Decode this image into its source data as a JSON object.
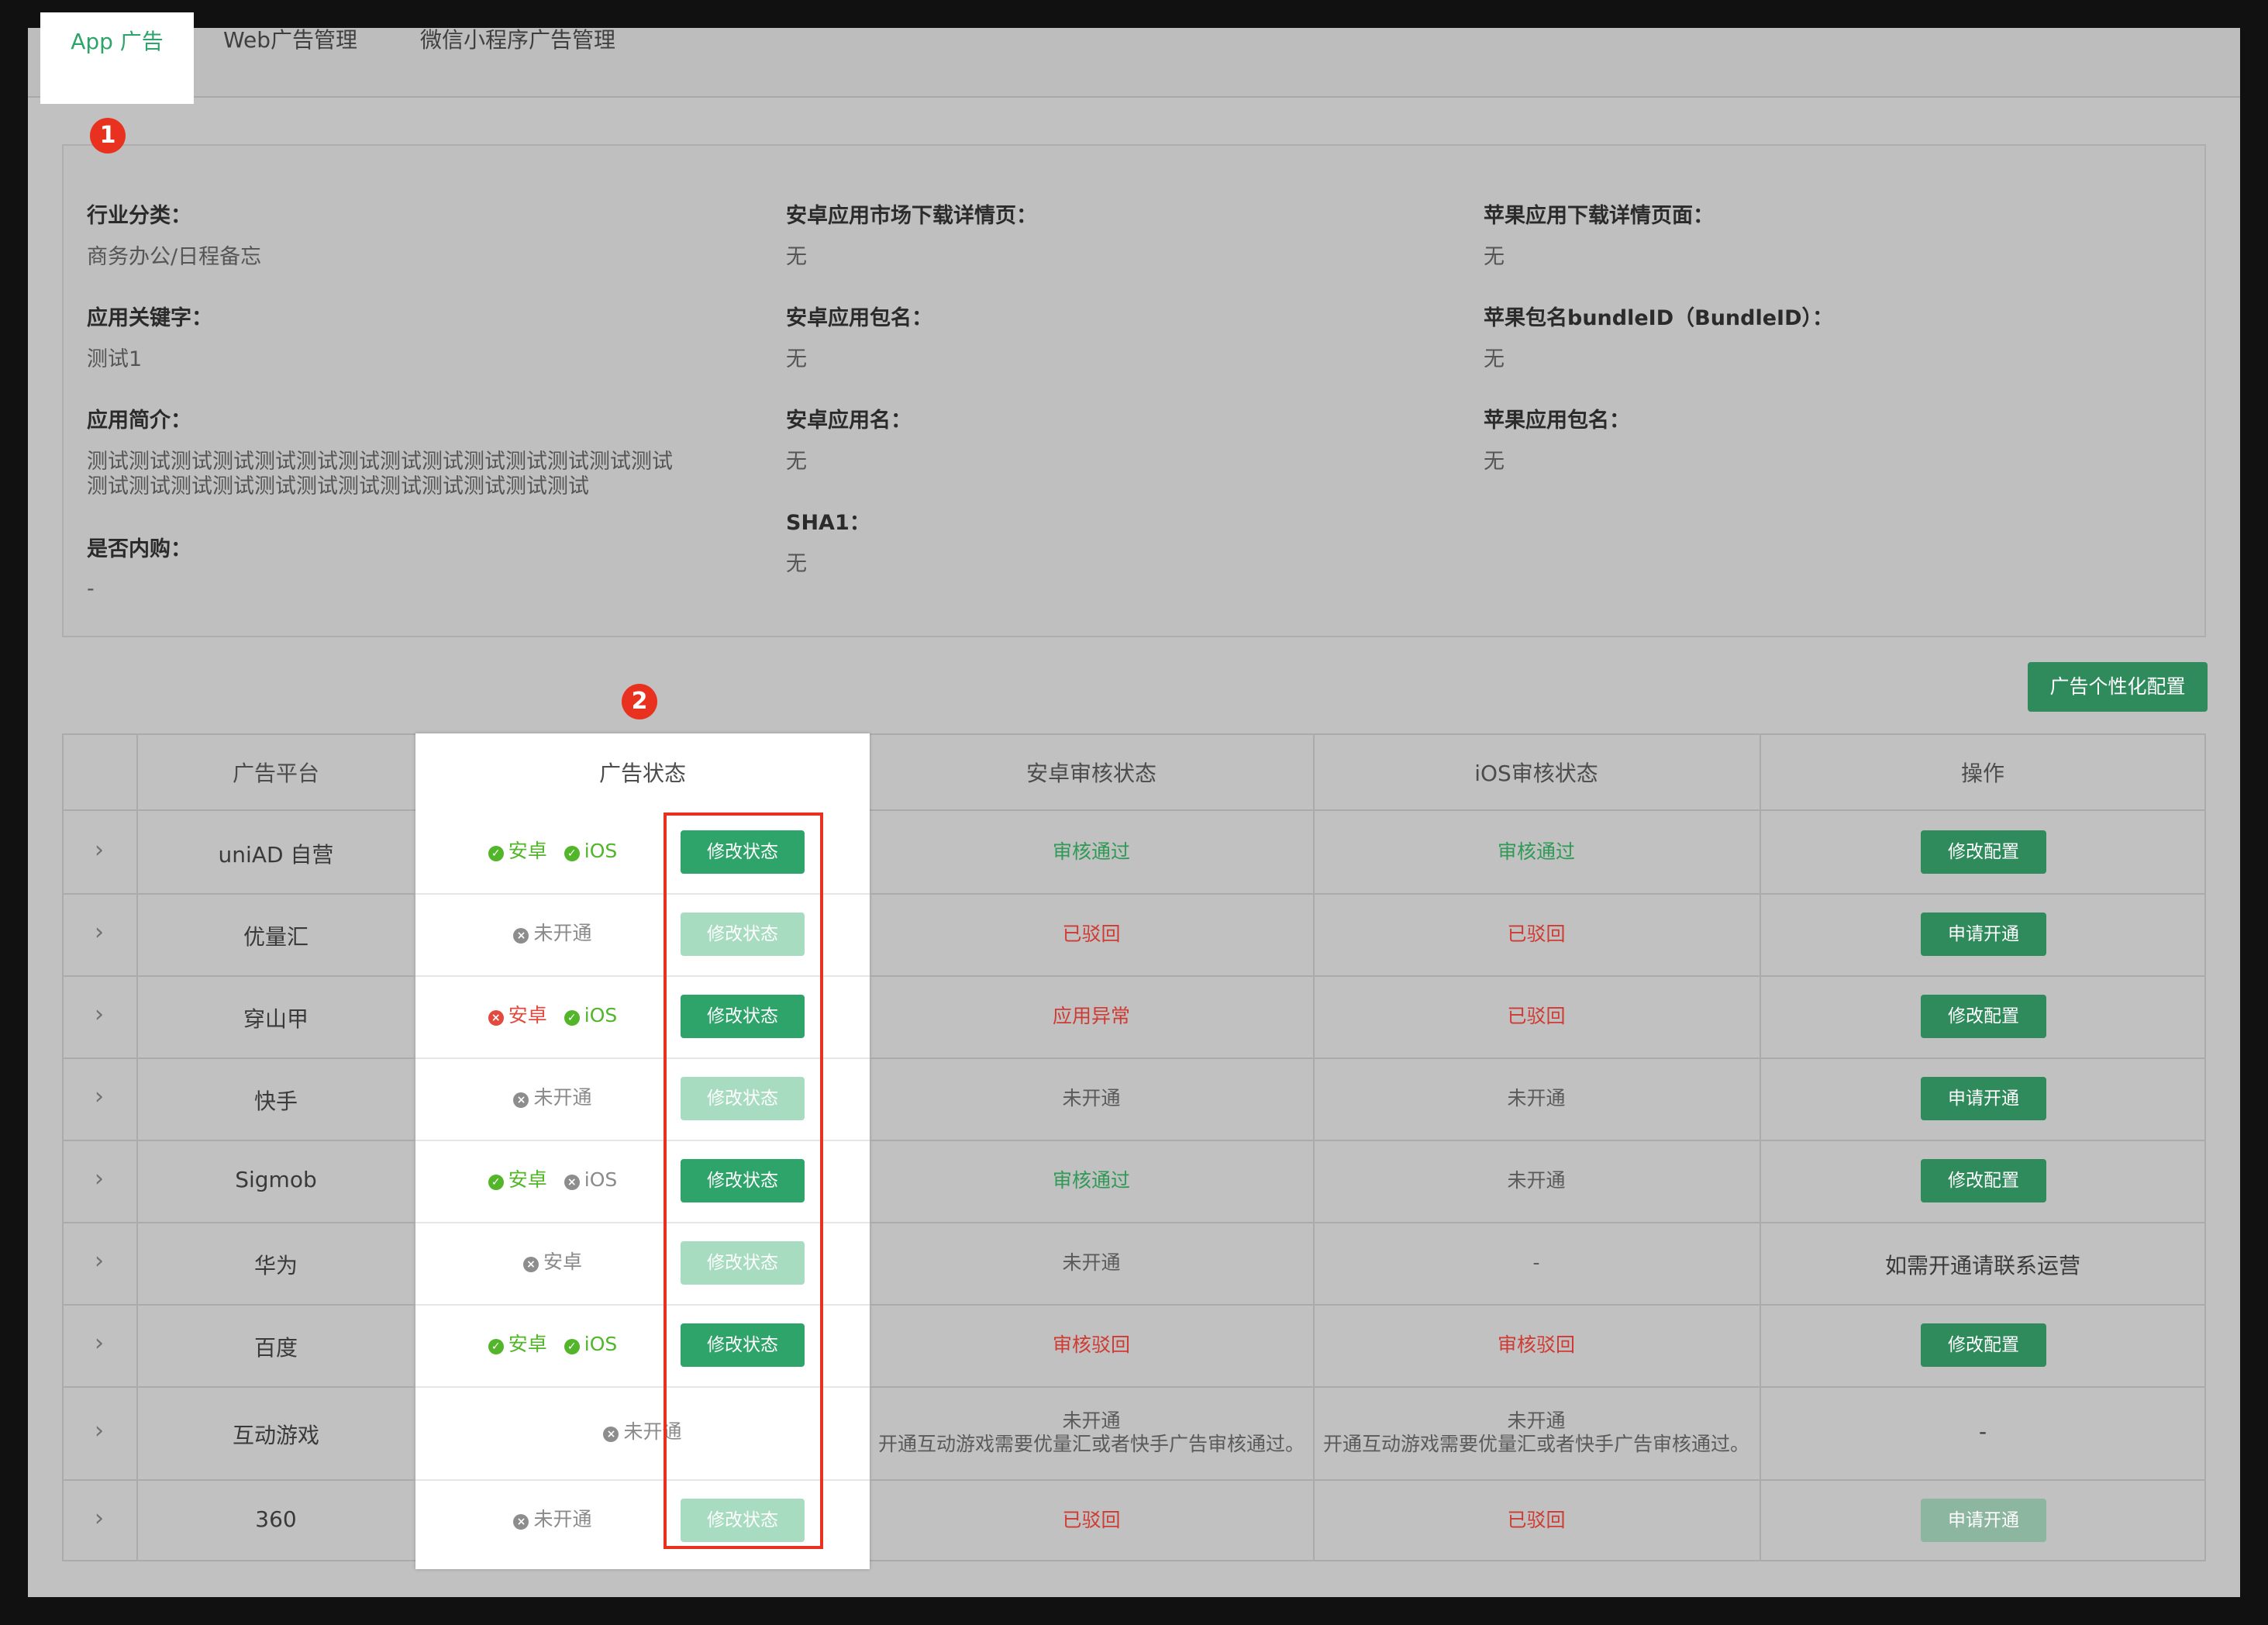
{
  "tabs": [
    {
      "label": "App 广告",
      "active": true
    },
    {
      "label": "Web广告管理",
      "active": false
    },
    {
      "label": "微信小程序广告管理",
      "active": false
    }
  ],
  "markers": {
    "one": "1",
    "two": "2"
  },
  "info": {
    "industry": {
      "label": "行业分类：",
      "value": "商务办公/日程备忘"
    },
    "keywords": {
      "label": "应用关键字：",
      "value": "测试1"
    },
    "intro": {
      "label": "应用简介：",
      "line1": "测试测试测试测试测试测试测试测试测试测试测试测试测试测试",
      "line2": "测试测试测试测试测试测试测试测试测试测试测试测试"
    },
    "iap": {
      "label": "是否内购：",
      "value": "-"
    },
    "android_market": {
      "label": "安卓应用市场下载详情页：",
      "value": "无"
    },
    "android_package": {
      "label": "安卓应用包名：",
      "value": "无"
    },
    "android_name": {
      "label": "安卓应用名：",
      "value": "无"
    },
    "sha1": {
      "label": "SHA1：",
      "value": "无"
    },
    "apple_download": {
      "label": "苹果应用下载详情页面：",
      "value": "无"
    },
    "apple_bundle": {
      "label": "苹果包名bundleID（BundleID）：",
      "value": "无"
    },
    "apple_package": {
      "label": "苹果应用包名：",
      "value": "无"
    }
  },
  "config_button": "广告个性化配置",
  "table": {
    "headers": [
      "广告平台",
      "广告状态",
      "安卓审核状态",
      "iOS审核状态",
      "操作"
    ],
    "rows": [
      {
        "platform": "uniAD 自营",
        "status": [
          {
            "icon": "ok",
            "text": "安卓"
          },
          {
            "icon": "ok",
            "text": "iOS"
          }
        ],
        "modify": "修改状态",
        "modify_enabled": true,
        "android": {
          "text": "审核通过",
          "tone": "green"
        },
        "ios": {
          "text": "审核通过",
          "tone": "green"
        },
        "op": {
          "type": "button",
          "text": "修改配置",
          "enabled": true
        }
      },
      {
        "platform": "优量汇",
        "status": [
          {
            "icon": "off",
            "text": "未开通"
          }
        ],
        "modify": "修改状态",
        "modify_enabled": false,
        "android": {
          "text": "已驳回",
          "tone": "red"
        },
        "ios": {
          "text": "已驳回",
          "tone": "red"
        },
        "op": {
          "type": "button",
          "text": "申请开通",
          "enabled": true
        }
      },
      {
        "platform": "穿山甲",
        "status": [
          {
            "icon": "no",
            "text": "安卓"
          },
          {
            "icon": "ok",
            "text": "iOS"
          }
        ],
        "modify": "修改状态",
        "modify_enabled": true,
        "android": {
          "text": "应用异常",
          "tone": "red"
        },
        "ios": {
          "text": "已驳回",
          "tone": "red"
        },
        "op": {
          "type": "button",
          "text": "修改配置",
          "enabled": true
        }
      },
      {
        "platform": "快手",
        "status": [
          {
            "icon": "off",
            "text": "未开通"
          }
        ],
        "modify": "修改状态",
        "modify_enabled": false,
        "android": {
          "text": "未开通",
          "tone": "gray"
        },
        "ios": {
          "text": "未开通",
          "tone": "gray"
        },
        "op": {
          "type": "button",
          "text": "申请开通",
          "enabled": true
        }
      },
      {
        "platform": "Sigmob",
        "status": [
          {
            "icon": "ok",
            "text": "安卓"
          },
          {
            "icon": "off",
            "text": "iOS"
          }
        ],
        "modify": "修改状态",
        "modify_enabled": true,
        "android": {
          "text": "审核通过",
          "tone": "green"
        },
        "ios": {
          "text": "未开通",
          "tone": "gray"
        },
        "op": {
          "type": "button",
          "text": "修改配置",
          "enabled": true
        }
      },
      {
        "platform": "华为",
        "status": [
          {
            "icon": "off",
            "text": "安卓"
          }
        ],
        "modify": "修改状态",
        "modify_enabled": false,
        "android": {
          "text": "未开通",
          "tone": "gray"
        },
        "ios": {
          "text": "-",
          "tone": "gray"
        },
        "op": {
          "type": "text",
          "text": "如需开通请联系运营"
        }
      },
      {
        "platform": "百度",
        "status": [
          {
            "icon": "ok",
            "text": "安卓"
          },
          {
            "icon": "ok",
            "text": "iOS"
          }
        ],
        "modify": "修改状态",
        "modify_enabled": true,
        "android": {
          "text": "审核驳回",
          "tone": "red"
        },
        "ios": {
          "text": "审核驳回",
          "tone": "red"
        },
        "op": {
          "type": "button",
          "text": "修改配置",
          "enabled": true
        }
      },
      {
        "platform": "互动游戏",
        "status": [
          {
            "icon": "off",
            "text": "未开通"
          }
        ],
        "modify": "",
        "modify_enabled": false,
        "android": {
          "text": "未开通",
          "tone": "gray",
          "note": "开通互动游戏需要优量汇或者快手广告审核通过。"
        },
        "ios": {
          "text": "未开通",
          "tone": "gray",
          "note": "开通互动游戏需要优量汇或者快手广告审核通过。"
        },
        "op": {
          "type": "text",
          "text": "-"
        }
      },
      {
        "platform": "360",
        "status": [
          {
            "icon": "off",
            "text": "未开通"
          }
        ],
        "modify": "修改状态",
        "modify_enabled": false,
        "android": {
          "text": "已驳回",
          "tone": "red"
        },
        "ios": {
          "text": "已驳回",
          "tone": "red"
        },
        "op": {
          "type": "button",
          "text": "申请开通",
          "enabled": false
        }
      }
    ]
  }
}
